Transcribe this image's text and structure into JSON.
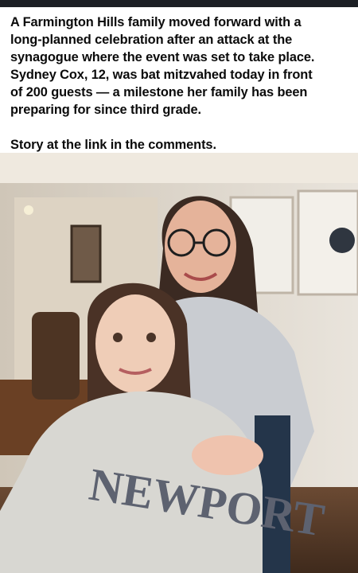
{
  "post": {
    "caption": "A Farmington Hills family moved forward with a\nlong-planned celebration after an attack at the\nsynagogue where the event was set to take place.\nSydney Cox, 12, was bat mitzvahed today in front\nof 200 guests — a milestone her family has been\npreparing for since third grade.",
    "cta": "Story at the link in the comments."
  },
  "photo": {
    "sweatshirt_text": "NEWPORT"
  }
}
